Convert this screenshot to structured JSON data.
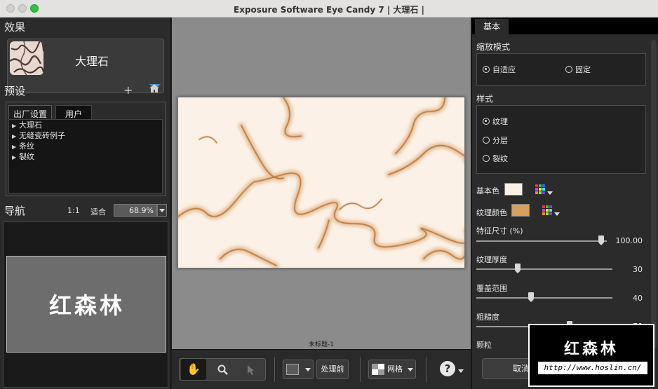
{
  "window": {
    "title": "Exposure Software Eye Candy 7 | 大理石 |"
  },
  "left": {
    "effect_heading": "效果",
    "effect_name": "大理石",
    "preset_heading": "预设",
    "tabs": [
      "出厂设置",
      "用户"
    ],
    "presets": [
      "大理石",
      "无缝瓷砖例子",
      "条纹",
      "裂纹"
    ],
    "nav_heading": "导航",
    "zoom_one": "1:1",
    "zoom_fit": "适合",
    "zoom_value": "68.9%",
    "nav_watermark": "红森林"
  },
  "center": {
    "doc_title": "未标题-1",
    "before_label": "处理前",
    "grid_label": "网格"
  },
  "right": {
    "tab": "基本",
    "scale_mode_label": "缩放模式",
    "scale_options": [
      "自适应",
      "固定"
    ],
    "style_label": "样式",
    "style_options": [
      "纹理",
      "分层",
      "裂纹"
    ],
    "base_color_label": "基本色",
    "base_color": "#fbf1e6",
    "texture_color_label": "纹理颜色",
    "texture_color": "#d3a05e",
    "feature_size_label": "特征尺寸 (%)",
    "feature_size_value": "100.00",
    "feature_size": 100,
    "thickness_label": "纹理厚度",
    "thickness_value": "30",
    "thickness": 30,
    "coverage_label": "覆盖范围",
    "coverage_value": "40",
    "coverage": 40,
    "roughness_label": "粗糙度",
    "roughness_value": "70",
    "roughness": 70,
    "grain_label": "颗粒",
    "cancel_label": "取消"
  },
  "watermark": {
    "title": "红森林",
    "url": "http://www.hoslin.cn/"
  }
}
